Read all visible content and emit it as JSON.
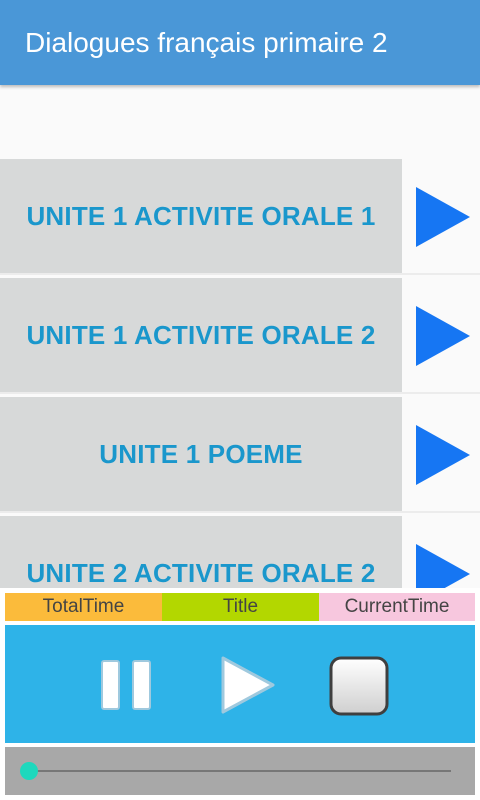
{
  "app": {
    "title": "Dialogues français primaire 2"
  },
  "tracks": [
    {
      "label": "UNITE 1 ACTIVITE ORALE 1",
      "play_icon": "play-icon"
    },
    {
      "label": "UNITE 1 ACTIVITE ORALE 2",
      "play_icon": "play-icon"
    },
    {
      "label": "UNITE 1 POEME",
      "play_icon": "play-icon"
    },
    {
      "label": "UNITE 2 ACTIVITE ORALE 2",
      "play_icon": "play-icon"
    }
  ],
  "player": {
    "total_time_label": "TotalTime",
    "title_label": "Title",
    "current_time_label": "CurrentTime",
    "controls": [
      "pause-icon",
      "play-icon",
      "stop-icon"
    ],
    "progress": 0
  },
  "colors": {
    "app_bar": "#4a97d7",
    "track_text": "#1a97cc",
    "play_arrow": "#1676f3",
    "controls_bg": "#2eb3e8",
    "total_bg": "#fbbb3b",
    "title_bg": "#b3d700",
    "current_bg": "#f7c7de",
    "seek_thumb": "#1ed8bd"
  }
}
